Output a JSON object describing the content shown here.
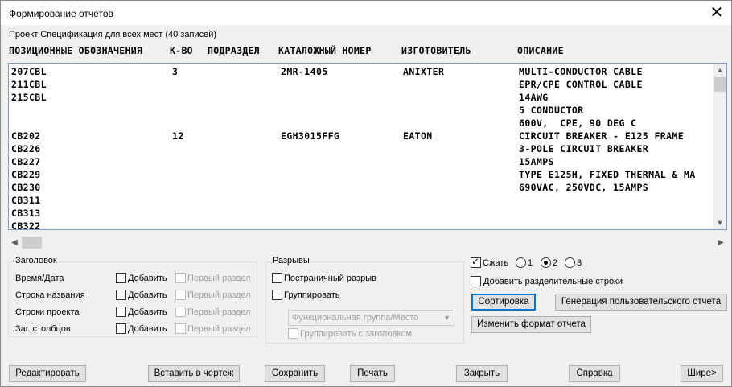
{
  "window": {
    "title": "Формирование отчетов",
    "close_glyph": "✕"
  },
  "project_label": "Проект Спецификация для всех мест (40 записей)",
  "columns": [
    "ПОЗИЦИОННЫЕ ОБОЗНАЧЕНИЯ",
    "К-ВО",
    "ПОДРАЗДЕЛ",
    "КАТАЛОЖНЫЙ НОМЕР",
    "ИЗГОТОВИТЕЛЬ",
    "ОПИСАНИЕ"
  ],
  "rows": {
    "tags": "207CBL\n211CBL\n215CBL\n\n\nCB202\nCB226\nCB227\nCB229\nCB230\nCB311\nCB313\nCB322",
    "qty": "3\n\n\n\n\n12",
    "subassembly": "",
    "catalog": "2MR-1405\n\n\n\n\nEGH3015FFG",
    "manufacturer": "ANIXTER\n\n\n\n\nEATON",
    "description": "MULTI-CONDUCTOR CABLE\nEPR/CPE CONTROL CABLE\n14AWG\n5 CONDUCTOR\n600V,  CPE, 90 DEG C\nCIRCUIT BREAKER - E125 FRAME\n3-POLE CIRCUIT BREAKER\n15AMPS\nTYPE E125H, FIXED THERMAL & MA\n690VAC, 250VDC, 15AMPS"
  },
  "header_group": {
    "title": "Заголовок",
    "rows": [
      {
        "label": "Время/Дата",
        "add": "Добавить",
        "first": "Первый раздел"
      },
      {
        "label": "Строка названия",
        "add": "Добавить",
        "first": "Первый раздел"
      },
      {
        "label": "Строки проекта",
        "add": "Добавить",
        "first": "Первый раздел"
      },
      {
        "label": "Заг. столбцов",
        "add": "Добавить",
        "first": "Первый раздел"
      }
    ]
  },
  "breaks_group": {
    "title": "Разрывы",
    "page_break": "Постраничный разрыв",
    "group": "Группировать",
    "group_select": "Функциональная группа/Место",
    "group_with_header": "Группировать с заголовком"
  },
  "compress": {
    "label": "Сжать",
    "checked": true,
    "options": [
      "1",
      "2",
      "3"
    ],
    "selected": "2"
  },
  "add_separator": "Добавить разделительные строки",
  "buttons": {
    "sort": "Сортировка",
    "user_report": "Генерация пользовательского отчета",
    "change_format": "Изменить формат отчета",
    "edit": "Редактировать",
    "insert": "Вставить в чертеж",
    "save": "Сохранить",
    "print": "Печать",
    "close": "Закрыть",
    "help": "Справка",
    "wider": "Шире>"
  }
}
